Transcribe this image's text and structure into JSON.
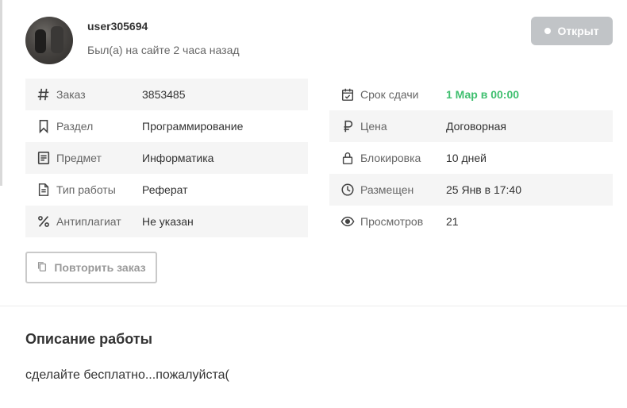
{
  "user": {
    "name": "user305694",
    "last_seen": "Был(а) на сайте 2 часа назад"
  },
  "status_button": {
    "label": "Открыт"
  },
  "details_left": [
    {
      "icon": "hash-icon",
      "label": "Заказ",
      "value": "3853485"
    },
    {
      "icon": "bookmark-icon",
      "label": "Раздел",
      "value": "Программирование"
    },
    {
      "icon": "book-icon",
      "label": "Предмет",
      "value": "Информатика"
    },
    {
      "icon": "document-icon",
      "label": "Тип работы",
      "value": "Реферат"
    },
    {
      "icon": "percent-icon",
      "label": "Антиплагиат",
      "value": "Не указан"
    }
  ],
  "details_right": [
    {
      "icon": "calendar-check-icon",
      "label": "Срок сдачи",
      "value": "1 Мар в 00:00"
    },
    {
      "icon": "ruble-icon",
      "label": "Цена",
      "value": "Договорная"
    },
    {
      "icon": "lock-icon",
      "label": "Блокировка",
      "value": "10 дней"
    },
    {
      "icon": "clock-icon",
      "label": "Размещен",
      "value": "25 Янв в 17:40"
    },
    {
      "icon": "eye-icon",
      "label": "Просмотров",
      "value": "21"
    }
  ],
  "repeat_button": {
    "label": "Повторить заказ"
  },
  "description": {
    "title": "Описание работы",
    "text": "сделайте бесплатно...пожалуйста("
  },
  "colors": {
    "deadline": "#3fbf6f",
    "status_button_bg": "#c1c4c7",
    "row_shade": "#f5f5f5"
  }
}
